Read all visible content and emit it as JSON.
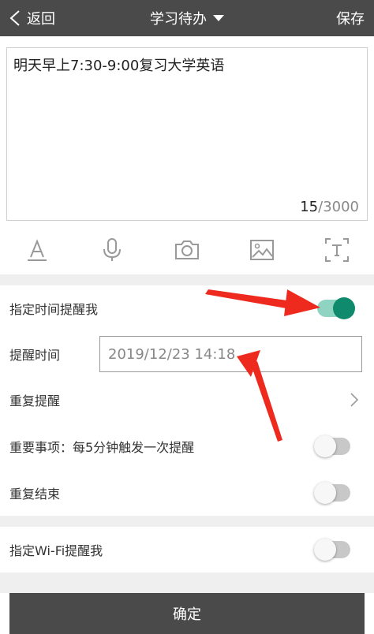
{
  "header": {
    "back_label": "返回",
    "title": "学习待办",
    "save_label": "保存"
  },
  "editor": {
    "content": "明天早上7:30-9:00复习大学英语",
    "count_current": "15",
    "count_sep": "/",
    "count_max": "3000"
  },
  "toolbar": {
    "icons": [
      "text-format-icon",
      "microphone-icon",
      "camera-icon",
      "image-icon",
      "text-recognition-icon"
    ]
  },
  "settings": {
    "remind_at_time": {
      "label": "指定时间提醒我",
      "enabled": true
    },
    "remind_time": {
      "label": "提醒时间",
      "value": "2019/12/23 14:18"
    },
    "repeat_remind": {
      "label": "重复提醒"
    },
    "important": {
      "label": "重要事项：每5分钟触发一次提醒",
      "enabled": false
    },
    "repeat_end": {
      "label": "重复结束",
      "enabled": false
    },
    "wifi_remind": {
      "label": "指定Wi-Fi提醒我",
      "enabled": false
    }
  },
  "confirm_label": "确定",
  "colors": {
    "topbar": "#4a4a4a",
    "toggle_on_knob": "#0f8a6c",
    "toggle_on_track": "#8fd4c2",
    "annotation_arrow": "#ee2a1f"
  }
}
